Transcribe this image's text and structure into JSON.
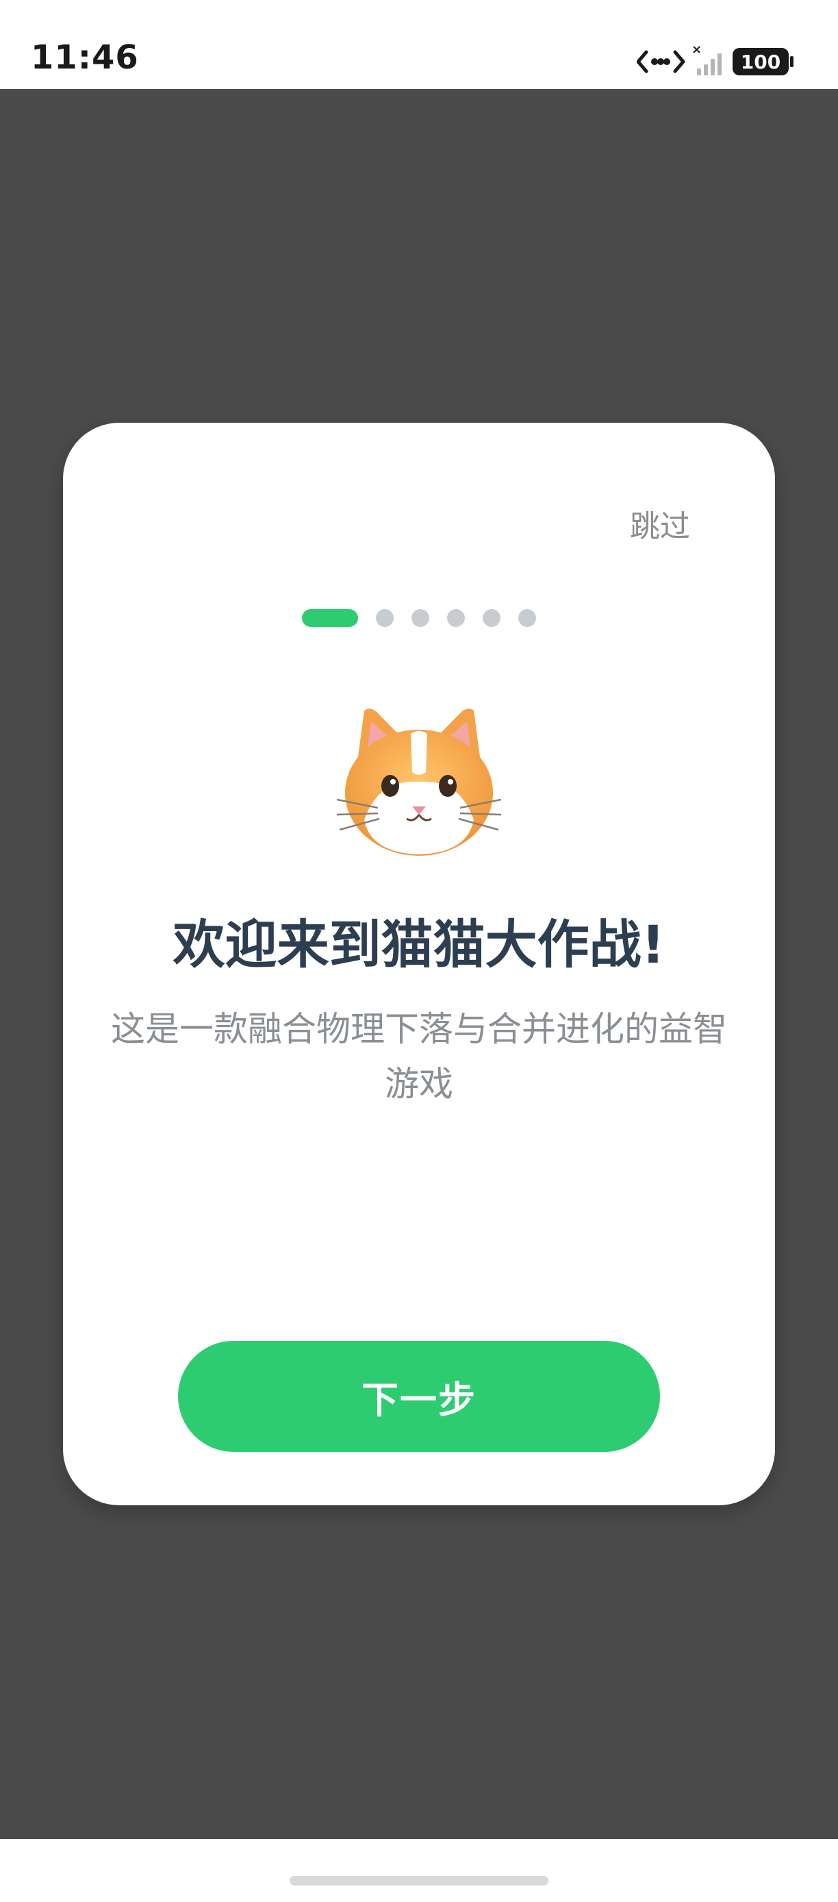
{
  "status_bar": {
    "time": "11:46",
    "battery": "100",
    "icons": [
      "data-transfer-icon",
      "signal-icon",
      "battery-icon"
    ]
  },
  "dialog": {
    "skip_label": "跳过",
    "pagination": {
      "total": 6,
      "current": 1
    },
    "mascot_icon": "cat-face-icon",
    "title": "欢迎来到猫猫大作战!",
    "description": "这是一款融合物理下落与合并进化的益智游戏",
    "next_label": "下一步"
  },
  "colors": {
    "accent": "#2ecc71",
    "title": "#2c3e50",
    "overlay": "#4b4b4b",
    "dot_inactive": "#c7ccd1"
  }
}
